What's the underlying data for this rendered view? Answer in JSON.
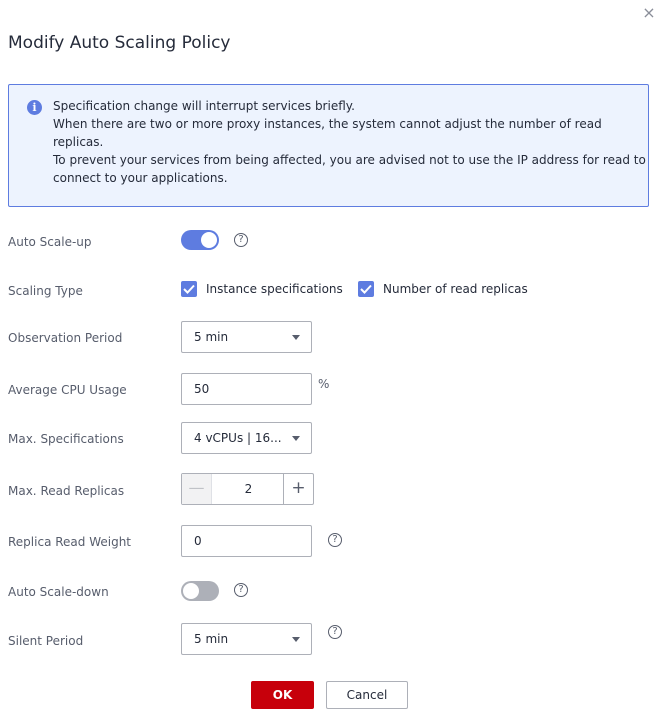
{
  "dialog": {
    "title": "Modify Auto Scaling Policy",
    "close_icon": "×"
  },
  "notice": {
    "icon": "info-icon",
    "lines": [
      "Specification change will interrupt services briefly.",
      "When there are two or more proxy instances, the system cannot adjust the number of read",
      "replicas.",
      "To prevent your services from being affected, you are advised not to use the IP address for read to",
      "connect to your applications."
    ]
  },
  "form": {
    "auto_scale_up": {
      "label": "Auto Scale-up",
      "enabled": true
    },
    "scaling_type": {
      "label": "Scaling Type",
      "options": [
        {
          "label": "Instance specifications",
          "checked": true
        },
        {
          "label": "Number of read replicas",
          "checked": true
        }
      ]
    },
    "observation_period": {
      "label": "Observation Period",
      "value": "5 min"
    },
    "average_cpu_usage": {
      "label": "Average CPU Usage",
      "value": "50",
      "unit": "%"
    },
    "max_specifications": {
      "label": "Max. Specifications",
      "value": "4 vCPUs | 16..."
    },
    "max_read_replicas": {
      "label": "Max. Read Replicas",
      "value": "2",
      "minus": "—",
      "plus": "+"
    },
    "replica_read_weight": {
      "label": "Replica Read Weight",
      "value": "0"
    },
    "auto_scale_down": {
      "label": "Auto Scale-down",
      "enabled": false
    },
    "silent_period": {
      "label": "Silent Period",
      "value": "5 min"
    }
  },
  "buttons": {
    "ok": "OK",
    "cancel": "Cancel"
  },
  "colors": {
    "accent": "#5e7ce0",
    "primary_button": "#c7000b",
    "notice_bg": "#edf3fe"
  }
}
